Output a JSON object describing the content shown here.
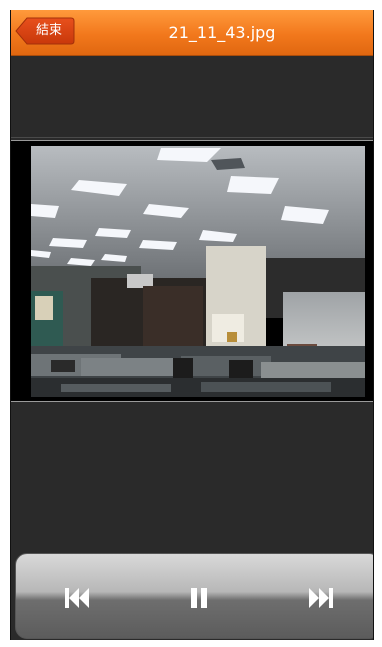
{
  "header": {
    "back_label": "結束",
    "title": "21_11_43.jpg"
  },
  "controls": {
    "previous_icon": "skip-previous-icon",
    "pause_icon": "pause-icon",
    "next_icon": "skip-next-icon"
  },
  "colors": {
    "header_orange": "#f2781c",
    "background": "#2a2a2a",
    "control_white": "#ffffff"
  }
}
